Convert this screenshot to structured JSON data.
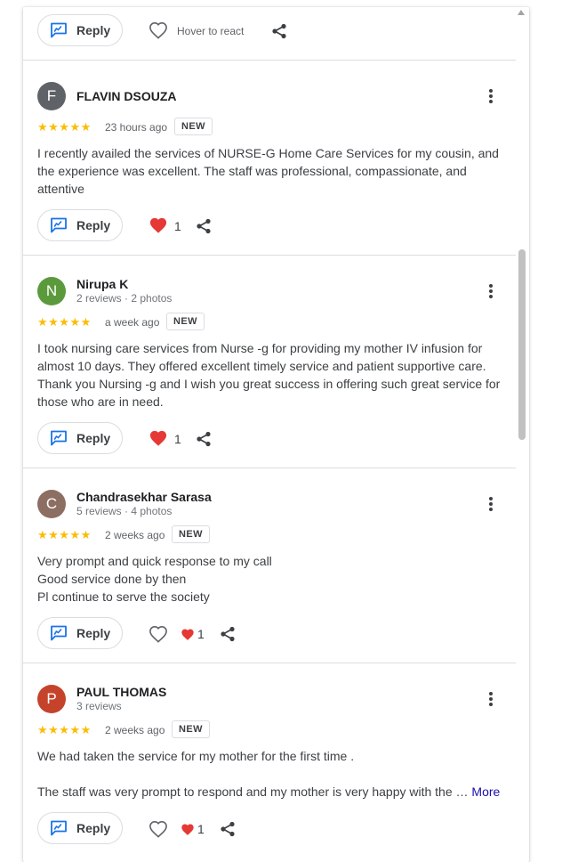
{
  "colors": {
    "star": "#fbbc04",
    "reply_icon": "#1a73e8",
    "heart": "#e53935",
    "avatar_flavin": "#5f6368",
    "avatar_nirupa": "#5b9a3c",
    "avatar_chandrasekhar": "#8d6e63",
    "avatar_paul": "#c5432a"
  },
  "top_actions": {
    "reply_label": "Reply",
    "hover_react_label": "Hover to react"
  },
  "reviews": [
    {
      "initial": "F",
      "name": "FLAVIN DSOUZA",
      "meta": "",
      "stars": "★★★★★",
      "date": "23 hours ago",
      "badge": "NEW",
      "text": "I recently availed the services of NURSE-G Home Care Services for my cousin, and the experience was excellent. The staff was professional, compassionate, and attentive",
      "reply_label": "Reply",
      "reaction_count": "1"
    },
    {
      "initial": "N",
      "name": "Nirupa K",
      "meta": "2 reviews · 2 photos",
      "stars": "★★★★★",
      "date": "a week ago",
      "badge": "NEW",
      "text": "I took nursing care services from Nurse -g for providing my mother IV infusion for almost 10 days. They offered excellent timely service and patient supportive care. Thank you Nursing -g and I wish you great success in offering such great service for those who are in need.",
      "reply_label": "Reply",
      "reaction_count": "1"
    },
    {
      "initial": "C",
      "name": "Chandrasekhar Sarasa",
      "meta": "5 reviews · 4 photos",
      "stars": "★★★★★",
      "date": "2 weeks ago",
      "badge": "NEW",
      "text_lines": [
        "Very prompt and quick response to my call",
        "Good service done by then",
        "Pl continue to serve the society"
      ],
      "reply_label": "Reply",
      "reaction_count": "1"
    },
    {
      "initial": "P",
      "name": "PAUL THOMAS",
      "meta": "3 reviews",
      "stars": "★★★★★",
      "date": "2 weeks ago",
      "badge": "NEW",
      "text_line1": "We had taken the service for my mother for the first time .",
      "text_line2": "The staff was very prompt to respond and my mother is very happy with the …",
      "more_label": "More",
      "reply_label": "Reply",
      "reaction_count": "1"
    }
  ]
}
